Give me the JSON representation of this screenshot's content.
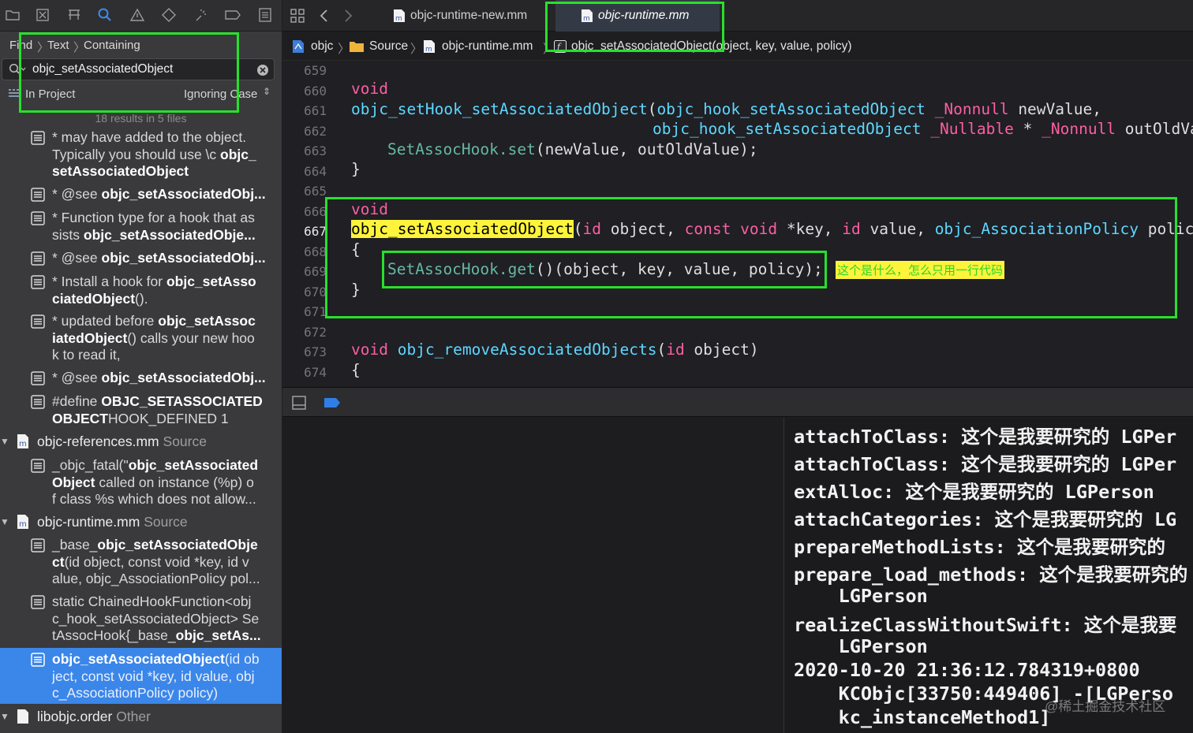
{
  "find": {
    "crumbs": [
      "Find",
      "Text",
      "Containing"
    ],
    "query": "objc_setAssociatedObject",
    "scope": "In Project",
    "case_mode": "Ignoring Case",
    "results_summary": "18 results in 5 files"
  },
  "results": {
    "r1": {
      "a": "*  may have added to the object.",
      "b1": "Typically you should use \\c ",
      "b2": "objc_",
      "c": "setAssociatedObject"
    },
    "r2": {
      "a": "* @see ",
      "b": "objc_setAssociatedObj..."
    },
    "r3": {
      "a": "* Function type for a hook that as",
      "b1": "sists ",
      "b2": "objc_setAssociatedObje..."
    },
    "r4": {
      "a": "* @see ",
      "b": "objc_setAssociatedObj..."
    },
    "r5": {
      "a1": "* Install a hook for ",
      "a2": "objc_setAsso",
      "b1": "ciatedObject",
      "b2": "()."
    },
    "r6": {
      "a1": "*  updated before ",
      "a2": "objc_setAssoc",
      "b1": "iatedObject",
      "b2": "() calls your new hoo",
      "c": "k to read it,"
    },
    "r7": {
      "a": "* @see ",
      "b": "objc_setAssociatedObj..."
    },
    "r8": {
      "a1": "#define ",
      "a2": "OBJC_SETASSOCIATED",
      "b1": "OBJECT",
      "b2": "HOOK_DEFINED 1"
    },
    "g1": {
      "name": "objc-references.mm",
      "type": "Source"
    },
    "r9": {
      "a1": "_objc_fatal(\"",
      "a2": "objc_setAssociated",
      "b1": "Object",
      "b2": " called on instance (%p) o",
      "c": "f class %s which does not allow..."
    },
    "g2": {
      "name": "objc-runtime.mm",
      "type": "Source"
    },
    "r10": {
      "a1": "_base_",
      "a2": "objc_setAssociatedObje",
      "b1": "ct",
      "b2": "(id object, const void *key, id v",
      "c": "alue, objc_AssociationPolicy pol..."
    },
    "r11": {
      "a": "static ChainedHookFunction<obj",
      "b": "c_hook_setAssociatedObject> Se",
      "c1": "tAssocHook{_base_",
      "c2": "objc_setAs..."
    },
    "r12": {
      "a1": "objc_setAssociatedObject",
      "a2": "(id ob",
      "b": "ject, const void *key, id value, obj",
      "c": "c_AssociationPolicy policy)"
    },
    "g3": {
      "name": "libobjc.order",
      "type": "Other"
    }
  },
  "tabs": [
    {
      "label": "objc-runtime-new.mm"
    },
    {
      "label": "objc-runtime.mm",
      "active": true
    }
  ],
  "breadcrumb": [
    "objc",
    "Source",
    "objc-runtime.mm",
    "objc_setAssociatedObject(object, key, value, policy)"
  ],
  "code": {
    "line_numbers": [
      "659",
      "660",
      "661",
      "662",
      "663",
      "664",
      "665",
      "666",
      "667",
      "668",
      "669",
      "670",
      "671",
      "672",
      "673",
      "674"
    ],
    "t": {
      "void": "void",
      "hook_fn": "objc_setHook_setAssociatedObject",
      "paren_open": "(",
      "hook_type": "objc_hook_setAssociatedObject",
      "nonnull": "_Nonnull",
      "nullable": "_Nullable",
      "newvalue": " newValue,",
      "star": " * ",
      "outold": " outOldVa",
      "assoc_set": "SetAssocHook",
      "dot_set": ".set",
      "set_args": "(newValue, outOldValue);",
      "brace_close": "}",
      "brace_open": "{",
      "sel_fn": "objc_setAssociatedObject",
      "id": "id",
      "object_comma": " object, ",
      "const": "const",
      "sp": " ",
      "key_comma": " *key, ",
      "value_comma": " value, ",
      "policy_type": "objc_AssociationPolicy",
      "policy_tail": " policy",
      "dot_get": ".get",
      "get_args": "()(object, key, value, policy);",
      "remove_fn": "objc_removeAssociatedObjects",
      "object_close": " object)"
    },
    "annotation": "这个是什么，怎么只用一行代码"
  },
  "console": {
    "lines": [
      "attachToClass: 这个是我要研究的 LGPer",
      "attachToClass: 这个是我要研究的 LGPer",
      "extAlloc: 这个是我要研究的 LGPerson",
      "attachCategories: 这个是我要研究的 LG",
      "prepareMethodLists: 这个是我要研究的",
      "prepare_load_methods: 这个是我要研究的",
      "    LGPerson",
      "realizeClassWithoutSwift: 这个是我要",
      "    LGPerson",
      "2020-10-20 21:36:12.784319+0800",
      "    KCObjc[33750:449406] -[LGPerso",
      "    kc_instanceMethod1]"
    ],
    "watermark": "@稀土掘金技术社区"
  },
  "colors": {
    "selection": "#3b86e9",
    "highlight_box": "#28e02c",
    "search_match": "#fef43b"
  }
}
